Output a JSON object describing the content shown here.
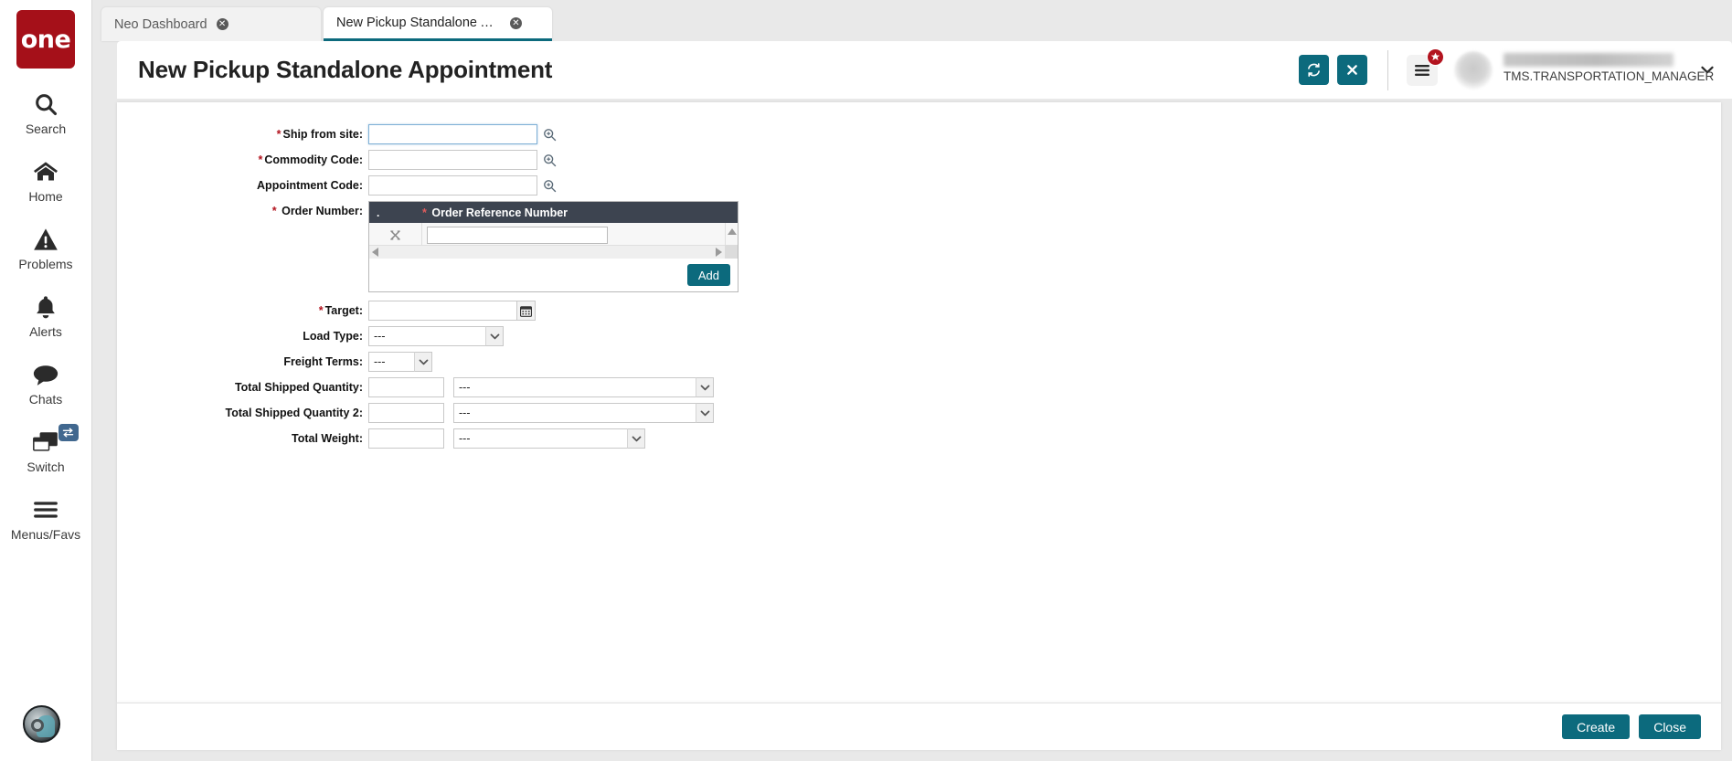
{
  "brand": {
    "logo_text": "one",
    "logo_color": "#a51019"
  },
  "theme": {
    "accent": "#0c6a7d",
    "grid_header": "#3d4450",
    "required": "#b3141f"
  },
  "rail": {
    "items": [
      {
        "label": "Search",
        "icon": "search-icon"
      },
      {
        "label": "Home",
        "icon": "home-icon"
      },
      {
        "label": "Problems",
        "icon": "warning-triangle-icon"
      },
      {
        "label": "Alerts",
        "icon": "bell-icon"
      },
      {
        "label": "Chats",
        "icon": "chat-bubble-icon"
      },
      {
        "label": "Switch",
        "icon": "windows-stack-icon",
        "badge_icon": "swap-arrows-icon"
      },
      {
        "label": "Menus/Favs",
        "icon": "hamburger-icon"
      }
    ],
    "avatar_icon": "robot-avatar-icon"
  },
  "tabs": [
    {
      "label": "Neo Dashboard",
      "active": false,
      "close_glyph": "✕"
    },
    {
      "label": "New Pickup Standalone Appoint...",
      "active": true,
      "close_glyph": "✕"
    }
  ],
  "header": {
    "title": "New Pickup Standalone Appointment",
    "refresh_icon": "refresh-icon",
    "close_icon": "close-x-icon",
    "menu_icon": "hamburger-menu-icon",
    "favorites_badge_icon": "star-icon",
    "user_role": "TMS.TRANSPORTATION_MANAGER",
    "user_caret_icon": "chevron-down-icon"
  },
  "form": {
    "ship_from_site": {
      "label": "Ship from site:",
      "required": true,
      "value": "",
      "lookup_icon": "magnifier-plus-icon",
      "focused": true
    },
    "commodity_code": {
      "label": "Commodity Code:",
      "required": true,
      "value": "",
      "lookup_icon": "magnifier-plus-icon"
    },
    "appointment_code": {
      "label": "Appointment Code:",
      "required": false,
      "value": "",
      "lookup_icon": "magnifier-plus-icon"
    },
    "order_number": {
      "label": "Order Number:",
      "required": true
    },
    "target": {
      "label": "Target:",
      "required": true,
      "value": "",
      "calendar_icon": "calendar-icon"
    },
    "load_type": {
      "label": "Load Type:",
      "required": false,
      "value": "---"
    },
    "freight_terms": {
      "label": "Freight Terms:",
      "required": false,
      "value": "---"
    },
    "total_shipped_qty": {
      "label": "Total Shipped Quantity:",
      "required": false,
      "value": "",
      "uom": "---"
    },
    "total_shipped_qty2": {
      "label": "Total Shipped Quantity 2:",
      "required": false,
      "value": "",
      "uom": "---"
    },
    "total_weight": {
      "label": "Total Weight:",
      "required": false,
      "value": "",
      "uom": "---"
    }
  },
  "order_grid": {
    "columns": [
      {
        "label": ".",
        "required": false
      },
      {
        "label": "Order Reference Number",
        "required": true
      }
    ],
    "rows": [
      {
        "delete_icon": "delete-x-icon",
        "order_reference_number": ""
      }
    ],
    "add_label": "Add",
    "scroll_up_icon": "triangle-up-icon",
    "scroll_down_icon": "triangle-down-icon",
    "scroll_left_icon": "triangle-left-icon",
    "scroll_right_icon": "triangle-right-icon"
  },
  "footer": {
    "create_label": "Create",
    "close_label": "Close"
  }
}
